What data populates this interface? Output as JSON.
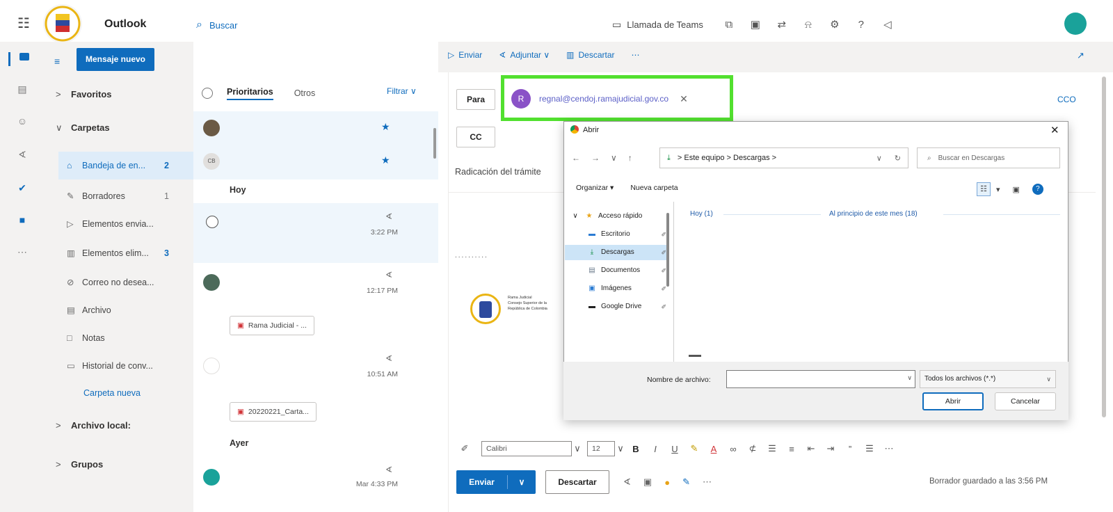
{
  "app": {
    "title": "Outlook"
  },
  "search": {
    "placeholder": "Buscar"
  },
  "topbar": {
    "teams_call": "Llamada de Teams"
  },
  "folders": {
    "new_message": "Mensaje nuevo",
    "favorites": "Favoritos",
    "folders_section": "Carpetas",
    "items": [
      {
        "label": "Bandeja de en...",
        "count": "2",
        "icon": "inbox-icon"
      },
      {
        "label": "Borradores",
        "count": "1",
        "icon": "pencil-icon"
      },
      {
        "label": "Elementos envia...",
        "count": "",
        "icon": "send-icon"
      },
      {
        "label": "Elementos elim...",
        "count": "3",
        "icon": "trash-icon"
      },
      {
        "label": "Correo no desea...",
        "count": "",
        "icon": "blocked-icon"
      },
      {
        "label": "Archivo",
        "count": "",
        "icon": "archive-icon"
      },
      {
        "label": "Notas",
        "count": "",
        "icon": "note-icon"
      },
      {
        "label": "Historial de conv...",
        "count": "",
        "icon": "folder-icon"
      }
    ],
    "new_folder": "Carpeta nueva",
    "local_archive": "Archivo local:",
    "groups": "Grupos"
  },
  "list": {
    "tab_priority": "Prioritarios",
    "tab_other": "Otros",
    "filter": "Filtrar",
    "group_today": "Hoy",
    "group_yesterday": "Ayer",
    "rows": [
      {
        "initials": "CB"
      },
      {
        "time": "3:22 PM"
      },
      {
        "time": "12:17 PM",
        "attachment": "Rama Judicial - ..."
      },
      {
        "time": "10:51 AM",
        "attachment": "20220221_Carta..."
      },
      {
        "time": "Mar 4:33 PM"
      }
    ]
  },
  "compose": {
    "send_tool": "Enviar",
    "attach_tool": "Adjuntar",
    "discard_tool": "Descartar",
    "to_label": "Para",
    "cc_label": "CC",
    "bcc_label": "CCO",
    "recipient_initial": "R",
    "recipient_email": "regnal@cendoj.ramajudicial.gov.co",
    "subject": "Radicación del trámite",
    "dots": "..........",
    "signature_lines": [
      "Rama Judicial",
      "Consejo Superior de la",
      "República de Colombia"
    ],
    "font": "Calibri",
    "size": "12",
    "send": "Enviar",
    "discard": "Descartar",
    "saved": "Borrador guardado a las 3:56 PM"
  },
  "dialog": {
    "title": "Abrir",
    "path_root": "Este equipo",
    "path_folder": "Descargas",
    "search_placeholder": "Buscar en Descargas",
    "organize": "Organizar",
    "new_folder": "Nueva carpeta",
    "tree": [
      {
        "label": "Acceso rápido",
        "icon": "star-icon"
      },
      {
        "label": "Escritorio",
        "icon": "desktop-icon"
      },
      {
        "label": "Descargas",
        "icon": "download-icon"
      },
      {
        "label": "Documentos",
        "icon": "document-icon"
      },
      {
        "label": "Imágenes",
        "icon": "image-icon"
      },
      {
        "label": "Google Drive",
        "icon": "drive-icon"
      }
    ],
    "group_today": "Hoy (1)",
    "group_month": "Al principio de este mes (18)",
    "filename_label": "Nombre de archivo:",
    "filetype": "Todos los archivos (*.*)",
    "open": "Abrir",
    "cancel": "Cancelar"
  }
}
